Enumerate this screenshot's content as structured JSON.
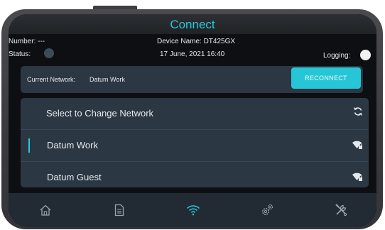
{
  "header": {
    "title": "Connect"
  },
  "info": {
    "number_label": "Number: ---",
    "device_name": "Device Name: DT425GX",
    "status_label": "Status:",
    "datetime": "17 June, 2021  16:40",
    "logging_label": "Logging:"
  },
  "current_network": {
    "label": "Current Network:",
    "value": "Datum Work",
    "reconnect_label": "RECONNECT"
  },
  "network_list": {
    "header": "Select to Change Network",
    "items": [
      {
        "name": "Datum Work",
        "selected": true,
        "icon": "wifi-lock-icon"
      },
      {
        "name": "Datum Guest",
        "selected": false,
        "icon": "wifi-lock-icon"
      }
    ]
  },
  "nav": {
    "items": [
      {
        "name": "home",
        "icon": "home-icon",
        "active": false
      },
      {
        "name": "documents",
        "icon": "document-icon",
        "active": false
      },
      {
        "name": "wifi",
        "icon": "wifi-icon",
        "active": true
      },
      {
        "name": "settings",
        "icon": "gears-icon",
        "active": false
      },
      {
        "name": "tools",
        "icon": "tools-icon",
        "active": false
      }
    ]
  },
  "colors": {
    "accent": "#27c9d8",
    "panel": "#2c3744",
    "screen_bg": "#0d0f12",
    "nav_bg": "#222a33",
    "icon_inactive": "#9aa3ab"
  }
}
